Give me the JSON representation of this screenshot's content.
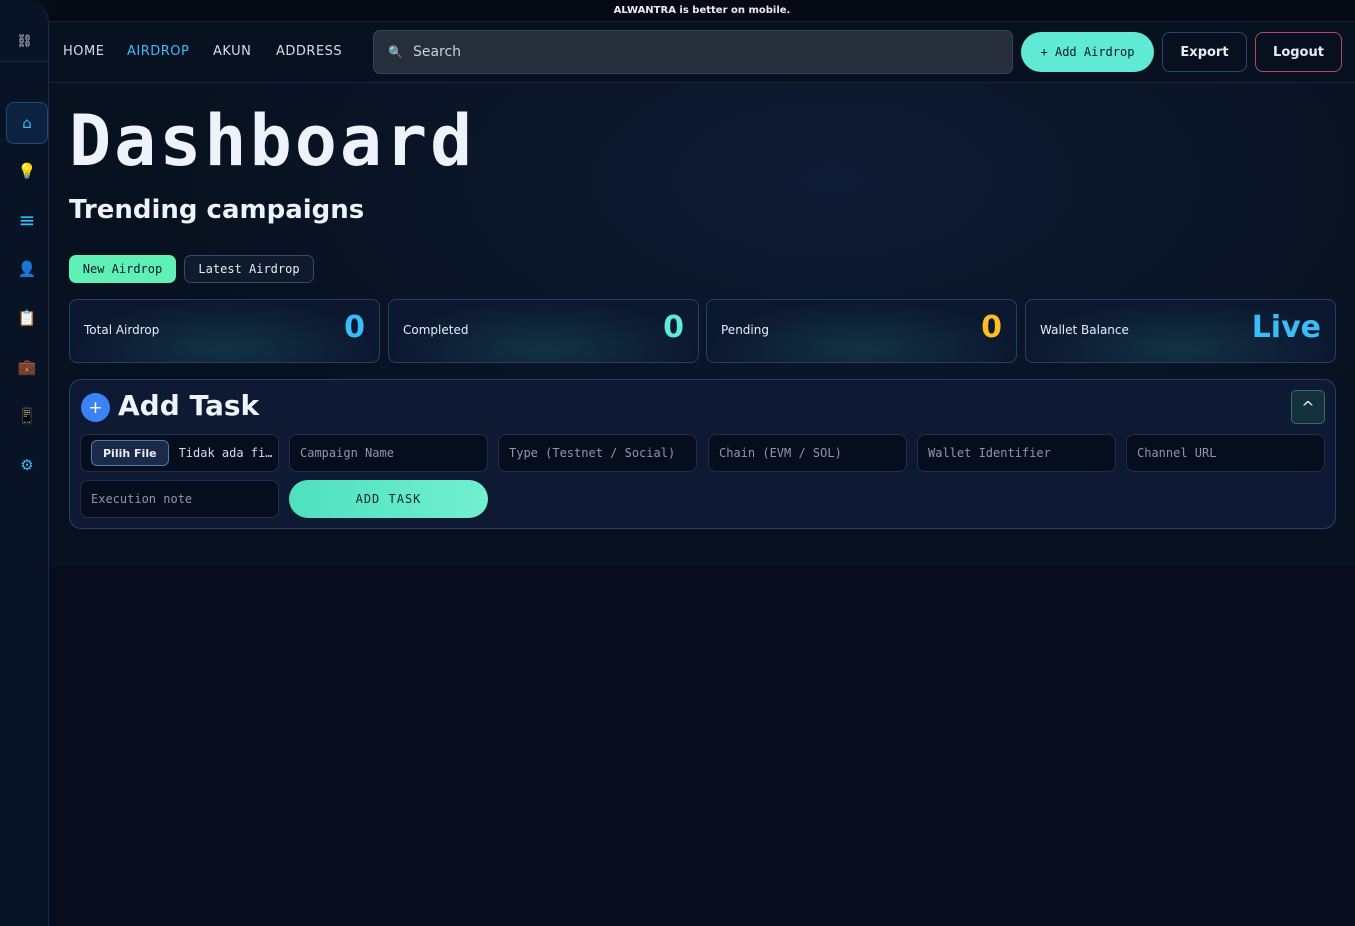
{
  "banner": {
    "text": "ALWANTRA is better on mobile."
  },
  "sidebar": {
    "logo": "⛓",
    "items": [
      {
        "name": "home-icon",
        "glyph": "⌂"
      },
      {
        "name": "lightbulb-icon",
        "glyph": "💡"
      },
      {
        "name": "list-icon",
        "glyph": "≡"
      },
      {
        "name": "user-icon",
        "glyph": "👤"
      },
      {
        "name": "clipboard-icon",
        "glyph": "📋"
      },
      {
        "name": "briefcase-icon",
        "glyph": "💼"
      },
      {
        "name": "phone-icon",
        "glyph": "📱"
      },
      {
        "name": "gear-icon",
        "glyph": "⚙"
      }
    ]
  },
  "nav": {
    "links": [
      "HOME",
      "AIRDROP",
      "AKUN",
      "ADDRESS"
    ],
    "active": "AIRDROP"
  },
  "search": {
    "placeholder": "Search",
    "icon": "🔍"
  },
  "toolbar": {
    "add_label": "+ Add Airdrop",
    "export_label": "Export",
    "logout_label": "Logout"
  },
  "main": {
    "title": "Dashboard",
    "section_title": "Trending campaigns",
    "pills": [
      "New Airdrop",
      "Latest Airdrop"
    ],
    "stats": [
      {
        "label": "Total Airdrop",
        "value": "0",
        "color": "#38bdf8"
      },
      {
        "label": "Completed",
        "value": "0",
        "color": "#5eead4"
      },
      {
        "label": "Pending",
        "value": "0",
        "color": "#fbbf24"
      },
      {
        "label": "Wallet Balance",
        "value": "Live",
        "color": "#38bdf8"
      }
    ]
  },
  "task": {
    "title": "Add Task",
    "plus": "+",
    "collapse": "^",
    "file_button": "Pilih File",
    "file_text": "Tidak ada fi…",
    "fields": {
      "campaign": "Campaign Name",
      "type": "Type (Testnet / Social)",
      "chain": "Chain (EVM / SOL)",
      "wallet": "Wallet Identifier",
      "channel": "Channel URL",
      "note": "Execution note"
    },
    "submit": "ADD TASK"
  }
}
